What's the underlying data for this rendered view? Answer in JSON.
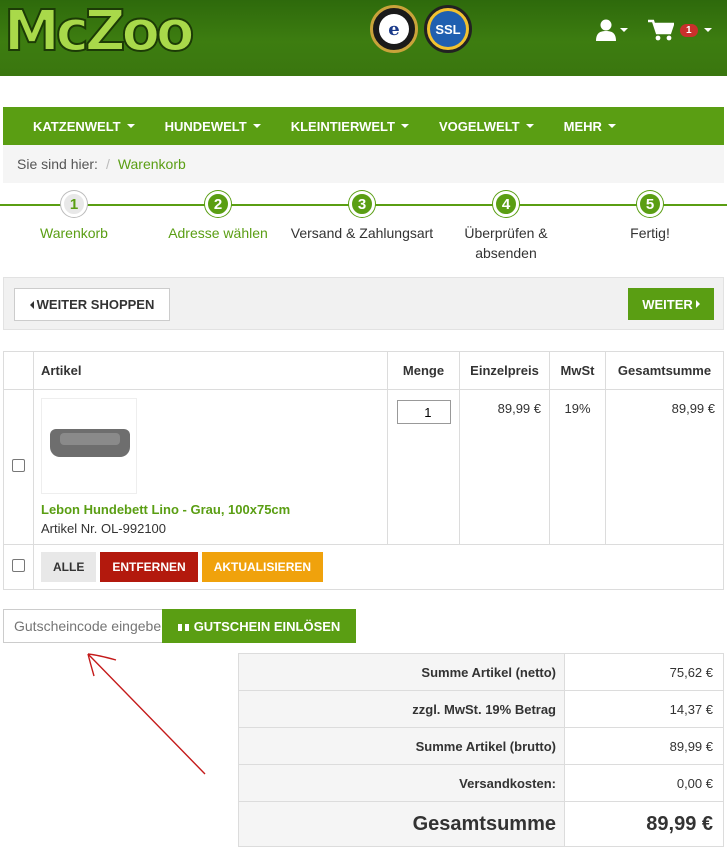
{
  "header": {
    "logo_text": "McZoo",
    "seal_trusted": "e",
    "seal_ssl": "SSL",
    "cart_count": "1",
    "colors": {
      "header_green": "#3d7d10",
      "accent_green": "#5a9e13"
    }
  },
  "nav": {
    "items": [
      {
        "label": "KATZENWELT"
      },
      {
        "label": "HUNDEWELT"
      },
      {
        "label": "KLEINTIERWELT"
      },
      {
        "label": "VOGELWELT"
      },
      {
        "label": "MEHR"
      }
    ]
  },
  "breadcrumb": {
    "prefix": "Sie sind hier:",
    "separator": "/",
    "current": "Warenkorb"
  },
  "steps": [
    {
      "number": "1",
      "label": "Warenkorb",
      "state": "active"
    },
    {
      "number": "2",
      "label": "Adresse wählen",
      "state": "link"
    },
    {
      "number": "3",
      "label": "Versand & Zahlungsart",
      "state": "normal"
    },
    {
      "number": "4",
      "label": "Überprüfen & absenden",
      "state": "normal"
    },
    {
      "number": "5",
      "label": "Fertig!",
      "state": "normal"
    }
  ],
  "actionbar": {
    "continue_shopping": "WEITER SHOPPEN",
    "next": "WEITER"
  },
  "cart": {
    "headers": {
      "artikel": "Artikel",
      "menge": "Menge",
      "einzelpreis": "Einzelpreis",
      "mwst": "MwSt",
      "gesamt": "Gesamtsumme"
    },
    "item": {
      "name": "Lebon Hundebett Lino - Grau, 100x75cm",
      "sku": "Artikel Nr. OL-992100",
      "quantity": "1",
      "unit_price": "89,99 €",
      "vat": "19%",
      "total": "89,99 €"
    },
    "buttons": {
      "all": "ALLE",
      "remove": "ENTFERNEN",
      "update": "AKTUALISIEREN"
    }
  },
  "coupon": {
    "placeholder": "Gutscheincode eingeben",
    "button": "GUTSCHEIN EINLÖSEN"
  },
  "totals": {
    "rows": [
      {
        "label": "Summe Artikel (netto)",
        "value": "75,62 €"
      },
      {
        "label": "zzgl. MwSt. 19% Betrag",
        "value": "14,37 €"
      },
      {
        "label": "Summe Artikel (brutto)",
        "value": "89,99 €"
      },
      {
        "label": "Versandkosten:",
        "value": "0,00 €"
      }
    ],
    "grand_label": "Gesamtsumme",
    "grand_value": "89,99 €"
  }
}
